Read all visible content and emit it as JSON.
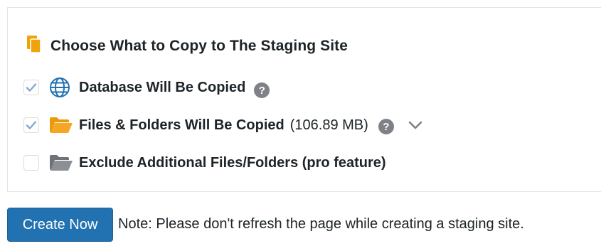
{
  "section": {
    "title": "Choose What to Copy to The Staging Site"
  },
  "options": [
    {
      "label": "Database Will Be Copied",
      "checked": true,
      "icon": "globe-icon",
      "has_help": true
    },
    {
      "label": "Files & Folders Will Be Copied",
      "size": "(106.89 MB)",
      "checked": true,
      "icon": "folder-open-icon",
      "has_help": true,
      "expandable": true
    },
    {
      "label": "Exclude Additional Files/Folders (pro feature)",
      "checked": false,
      "disabled": true,
      "icon": "folder-gray-icon"
    }
  ],
  "help_glyph": "?",
  "actions": {
    "create_label": "Create Now",
    "note": "Note: Please don't refresh the page while creating a staging site."
  },
  "colors": {
    "accent": "#2271b1",
    "folder_orange": "#f0a30a",
    "globe_blue": "#2271b1",
    "check": "#7fa9d6",
    "help_gray": "#7e8287"
  }
}
